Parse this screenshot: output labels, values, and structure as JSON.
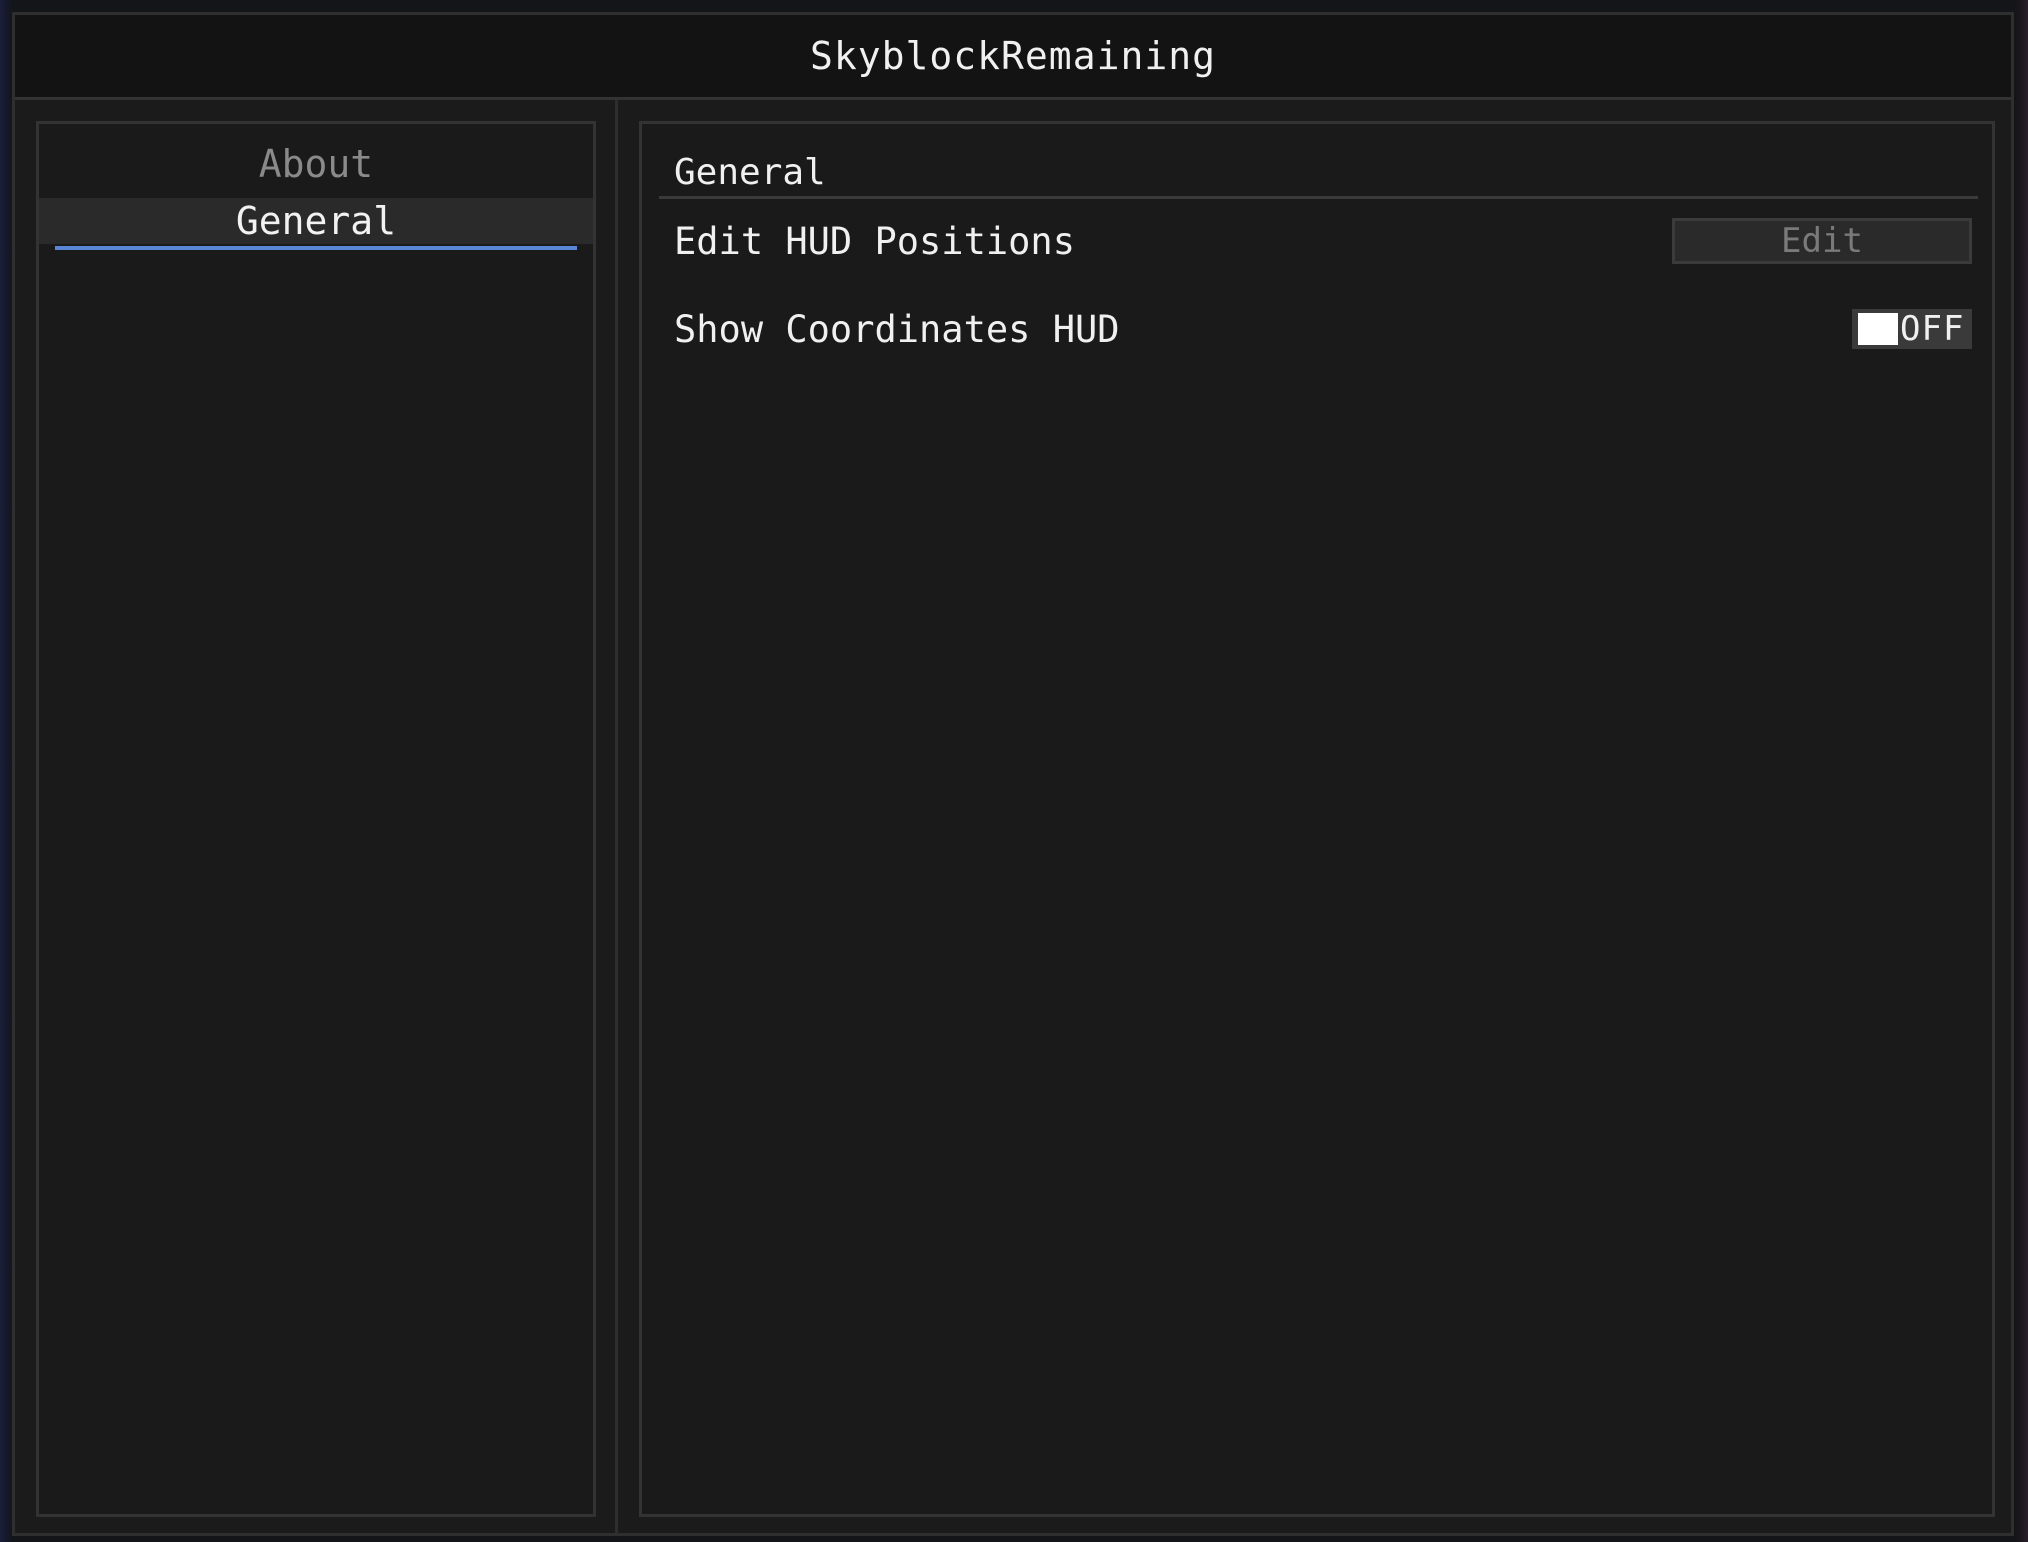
{
  "window": {
    "title": "SkyblockRemaining"
  },
  "sidebar": {
    "items": [
      {
        "label": "About",
        "active": false
      },
      {
        "label": "General",
        "active": true
      }
    ]
  },
  "main": {
    "section_title": "General",
    "options": [
      {
        "label": "Edit HUD Positions",
        "control": "button",
        "button_label": "Edit"
      },
      {
        "label": "Show Coordinates HUD",
        "control": "toggle",
        "toggle_state": "OFF"
      }
    ]
  },
  "colors": {
    "accent": "#5a86d6",
    "window_bg": "#1b1b1b",
    "titlebar_bg": "#131313"
  }
}
